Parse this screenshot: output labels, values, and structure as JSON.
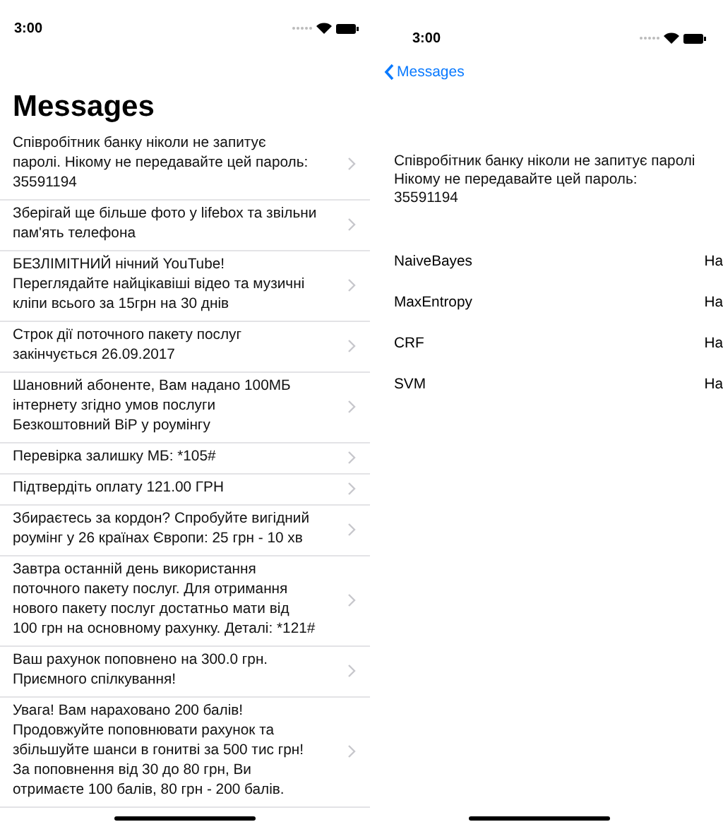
{
  "screens": [
    {
      "status_bar": {
        "time": "3:00"
      },
      "title": "Messages",
      "messages": [
        {
          "text": "Співробітник банку ніколи не запитує\nпаролі. Нікому не передавайте цей пароль:\n35591194"
        },
        {
          "text": "Зберігай ще більше фото у lifebox та звільни\nпам'ять телефона"
        },
        {
          "text": "БЕЗЛІМІТНИЙ нічний YouTube!\nПереглядайте найцікавіші відео та музичні\nкліпи всього за 15грн на 30 днів"
        },
        {
          "text": "Строк дії поточного пакету послуг\nзакінчується 26.09.2017"
        },
        {
          "text": "Шановний абоненте, Вам надано 100МБ\nінтернету згідно умов послуги\nБезкоштовний ВіР у роумінгу"
        },
        {
          "text": "Перевірка залишку МБ: *105#"
        },
        {
          "text": "Підтвердіть оплату  121.00 ГРН"
        },
        {
          "text": "Збираєтесь за кордон? Спробуйте вигідний\nроумінг у 26 країнах Європи: 25 грн - 10 хв"
        },
        {
          "text": "Завтра останній день використання\nпоточного пакету послуг. Для отримання\nнового пакету послуг достатньо мати від\n100 грн на основному рахунку. Деталі: *121#"
        },
        {
          "text": "Ваш рахунок поповнено на 300.0 грн.\nПриємного спілкування!"
        },
        {
          "text": "Увага! Вам нараховано 200 балів!\nПродовжуйте поповнювати рахунок та\nзбільшуйте шанси в гонитві за 500 тис грн!\nЗа поповнення від 30 до 80 грн, Ви\nотримаєте 100 балів, 80 грн - 200 балів."
        }
      ]
    },
    {
      "status_bar": {
        "time": "3:00"
      },
      "back_button": "Messages",
      "message": "Співробітник банку ніколи не запитує паролі\nНікому не передавайте цей пароль:\n35591194",
      "results": [
        {
          "label": "NaiveBayes",
          "value": "На"
        },
        {
          "label": "MaxEntropy",
          "value": "На"
        },
        {
          "label": "CRF",
          "value": "На"
        },
        {
          "label": "SVM",
          "value": "На"
        }
      ]
    }
  ]
}
